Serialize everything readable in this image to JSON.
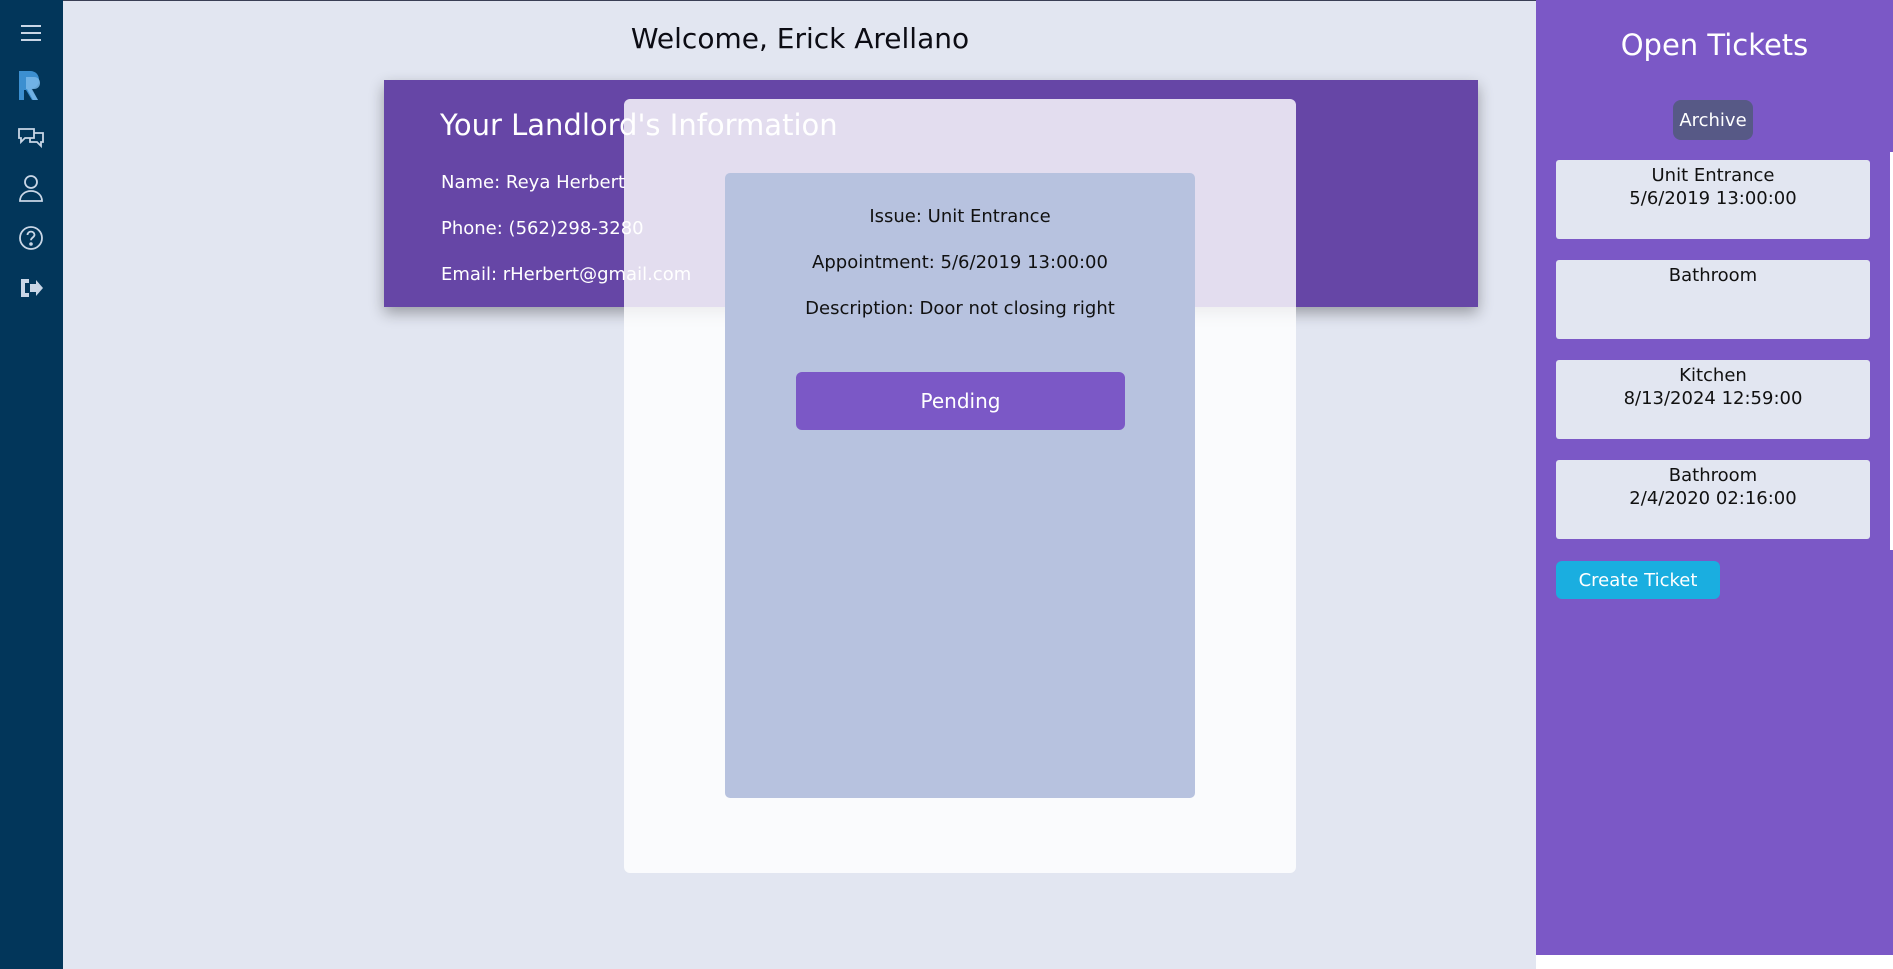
{
  "header": {
    "welcome": "Welcome,  Erick Arellano"
  },
  "nav": {
    "icons": [
      "menu-icon",
      "logo-icon",
      "chat-icon",
      "profile-icon",
      "help-icon",
      "logout-icon"
    ]
  },
  "landlord": {
    "title": "Your Landlord's Information",
    "name": "Name:  Reya  Herbert",
    "phone": "Phone: (562)298-3280",
    "email": "Email: rHerbert@gmail.com"
  },
  "ticket_detail": {
    "issue": "Issue: Unit  Entrance",
    "appointment": "Appointment: 5/6/2019 13:00:00",
    "description": "Description:  Door not closing right",
    "status_button": "Pending"
  },
  "tickets_panel": {
    "title": "Open Tickets",
    "archive_label": "Archive",
    "tickets": [
      {
        "issue": "Unit Entrance",
        "date": "5/6/2019 13:00:00"
      },
      {
        "issue": "Bathroom",
        "date": ""
      },
      {
        "issue": "Kitchen",
        "date": "8/13/2024 12:59:00"
      },
      {
        "issue": "Bathroom",
        "date": "2/4/2020 02:16:00"
      }
    ],
    "create_label": "Create Ticket"
  },
  "colors": {
    "nav_bg": "#02365a",
    "page_bg": "#e2e6f1",
    "landlord_bg": "#6646a6",
    "accent_purple": "#7b58c6",
    "card_bg": "#b7c2df",
    "create_button": "#1aaee0",
    "archive_button": "#575986"
  }
}
